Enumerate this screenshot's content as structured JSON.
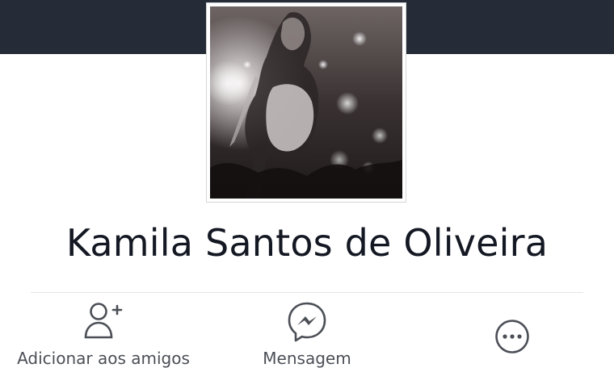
{
  "profile": {
    "name": "Kamila Santos de Oliveira"
  },
  "actions": {
    "add_friend_label": "Adicionar aos amigos",
    "message_label": "Mensagem",
    "more_label": ""
  },
  "icons": {
    "add_friend": "add-friend-icon",
    "message": "messenger-icon",
    "more": "more-options-icon"
  },
  "colors": {
    "cover_bar": "#252c38",
    "icon_gray": "#4b4f56",
    "name_text": "#141823"
  }
}
